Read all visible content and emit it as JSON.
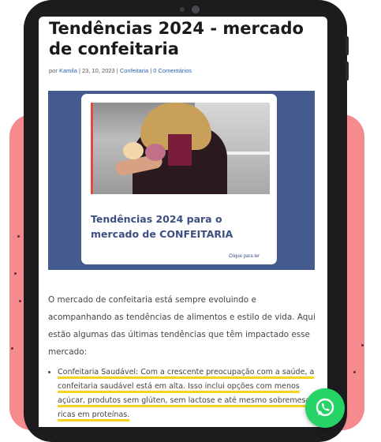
{
  "article": {
    "title": "Tendências 2024 - mercado de confeitaria",
    "meta": {
      "prefix": "por ",
      "author": "Kamila",
      "sep1": " | ",
      "date": "23, 10, 2023",
      "sep2": " | ",
      "category": "Confeitaria",
      "sep3": " | ",
      "comments": "0 Comentários"
    },
    "hero": {
      "card_title": "Tendências 2024 para o mercado de CONFEITARIA",
      "card_link": "Clique para ler"
    },
    "intro": "O mercado de confeitaria está sempre evoluindo e acompanhando as tendências de alimentos e estilo de vida. Aqui estão algumas das últimas tendências que têm impactado esse mercado:",
    "bullets": [
      "Confeitaria Saudável: Com a crescente preocupação com a saúde, a confeitaria saudável está em alta. Isso inclui opções com menos açúcar, produtos sem glúten, sem lactose e até mesmo sobremesas ricas em proteínas."
    ]
  },
  "icons": {
    "whatsapp": "whatsapp-icon"
  },
  "colors": {
    "background_shape": "#f58a8f",
    "hero_bg": "#455a8f",
    "card_text": "#3d4f80",
    "highlight": "#f5d320",
    "whatsapp": "#25d366"
  }
}
